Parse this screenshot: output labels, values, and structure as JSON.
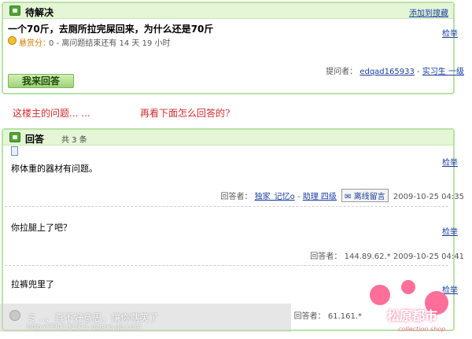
{
  "question": {
    "header": "待解决",
    "add_favorite": "添加到搜藏",
    "title": "一个70斤，去厕所拉完屎回来，为什么还是70斤",
    "report": "检举",
    "reward_label": "悬赏分：",
    "reward_info": "0 - 离问题结束还有 14 天 19 小时",
    "asker_label": "提问者：",
    "asker_name": "edqad165933",
    "asker_separator": " - ",
    "asker_level": "实习生 一级",
    "answer_button": "我来回答"
  },
  "caption": {
    "left": "这楼主的问题... ...",
    "right": "再看下面怎么回答的?"
  },
  "answers": {
    "header": "回答",
    "count": "共 3 条",
    "items": [
      {
        "text": "称体重的器材有问题。",
        "report": "检举",
        "label": "回答者：",
        "user": "独家_记忆o",
        "separator": " - ",
        "level": "助理 四级",
        "message": "离线留言",
        "time": "2009-10-25 04:35"
      },
      {
        "text": "你拉腿上了吧？",
        "report": "检举",
        "label": "回答者：",
        "ip": "144.89.62.*",
        "time": "2009-10-25 04:41"
      },
      {
        "text": "拉裤兜里了",
        "report": "检举",
        "label": "回答者：",
        "ip": "61.161.*"
      }
    ]
  },
  "watermark": {
    "text": "ミ ..、真不好意思，讓你瞎笑了",
    "url": "http://390131911.qzone.qq.com",
    "logo": "松原都市",
    "logo_sub": "collection shop"
  }
}
